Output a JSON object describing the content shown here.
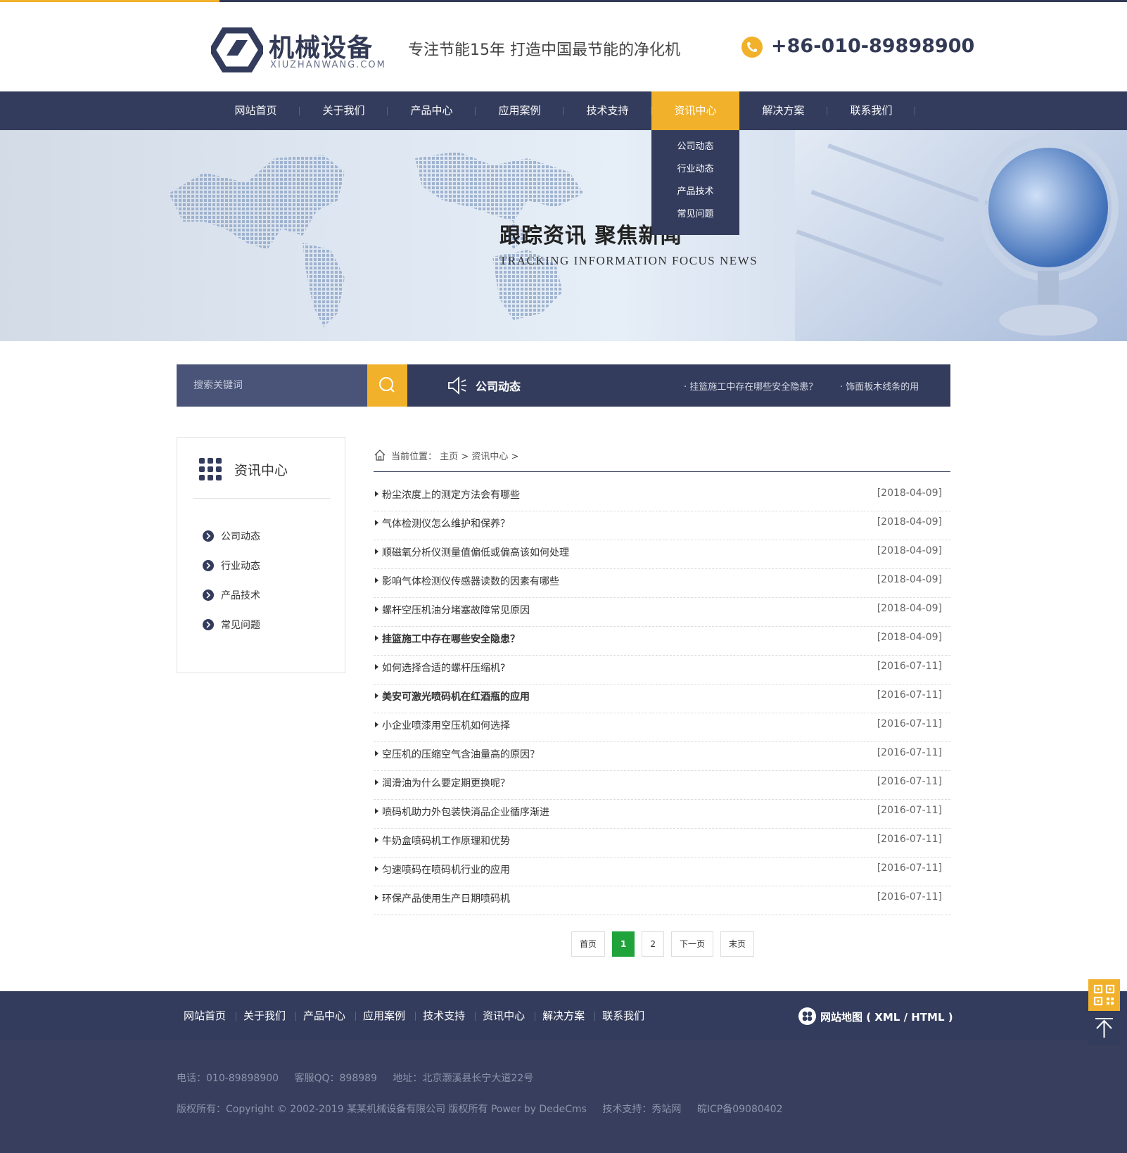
{
  "header": {
    "logo_title": "机械设备",
    "logo_sub": "XIUZHANWANG.COM",
    "slogan": "专注节能15年 打造中国最节能的净化机",
    "phone": "+86-010-89898900"
  },
  "nav": {
    "items": [
      "网站首页",
      "关于我们",
      "产品中心",
      "应用案例",
      "技术支持",
      "资讯中心",
      "解决方案",
      "联系我们"
    ],
    "active_index": 5,
    "dropdown": [
      "公司动态",
      "行业动态",
      "产品技术",
      "常见问题"
    ]
  },
  "banner": {
    "title": "跟踪资讯 聚焦新闻",
    "subtitle": "TRACKING INFORMATION FOCUS NEWS"
  },
  "search": {
    "placeholder": "搜索关键词",
    "ticker_label": "公司动态",
    "ticker_items": [
      "· 挂篮施工中存在哪些安全隐患？",
      "· 饰面板木线条的用"
    ]
  },
  "sidebar": {
    "title": "资讯中心",
    "items": [
      "公司动态",
      "行业动态",
      "产品技术",
      "常见问题"
    ]
  },
  "breadcrumb": {
    "prefix": "当前位置：",
    "home": "主页",
    "section": "资讯中心",
    "sep": ">"
  },
  "news": [
    {
      "title": "粉尘浓度上的测定方法会有哪些",
      "date": "[2018-04-09]",
      "bold": false
    },
    {
      "title": "气体检测仪怎么维护和保养？",
      "date": "[2018-04-09]",
      "bold": false
    },
    {
      "title": "顺磁氧分析仪测量值偏低或偏高该如何处理",
      "date": "[2018-04-09]",
      "bold": false
    },
    {
      "title": "影响气体检测仪传感器读数的因素有哪些",
      "date": "[2018-04-09]",
      "bold": false
    },
    {
      "title": "螺杆空压机油分堵塞故障常见原因",
      "date": "[2018-04-09]",
      "bold": false
    },
    {
      "title": "挂篮施工中存在哪些安全隐患？",
      "date": "[2018-04-09]",
      "bold": true
    },
    {
      "title": "如何选择合适的螺杆压缩机?",
      "date": "[2016-07-11]",
      "bold": false
    },
    {
      "title": "美安可激光喷码机在红酒瓶的应用",
      "date": "[2016-07-11]",
      "bold": true
    },
    {
      "title": "小企业喷漆用空压机如何选择",
      "date": "[2016-07-11]",
      "bold": false
    },
    {
      "title": "空压机的压缩空气含油量高的原因？",
      "date": "[2016-07-11]",
      "bold": false
    },
    {
      "title": "润滑油为什么要定期更换呢？",
      "date": "[2016-07-11]",
      "bold": false
    },
    {
      "title": "喷码机助力外包装快消品企业循序渐进",
      "date": "[2016-07-11]",
      "bold": false
    },
    {
      "title": "牛奶盒喷码机工作原理和优势",
      "date": "[2016-07-11]",
      "bold": false
    },
    {
      "title": "匀速喷码在喷码机行业的应用",
      "date": "[2016-07-11]",
      "bold": false
    },
    {
      "title": "环保产品使用生产日期喷码机",
      "date": "[2016-07-11]",
      "bold": false
    }
  ],
  "pager": {
    "first": "首页",
    "pages": [
      "1",
      "2"
    ],
    "current": "1",
    "next": "下一页",
    "last": "末页"
  },
  "footer_nav": {
    "items": [
      "网站首页",
      "关于我们",
      "产品中心",
      "应用案例",
      "技术支持",
      "资讯中心",
      "解决方案",
      "联系我们"
    ],
    "sitemap": "网站地图 ( XML / HTML )"
  },
  "footer": {
    "tel": "电话：010-89898900",
    "qq": "客服QQ：898989",
    "address": "地址：北京灏溪县长宁大道22号",
    "copyright": "版权所有：Copyright © 2002-2019 某某机械设备有限公司 版权所有 Power by DedeCms",
    "support": "技术支持：秀站网",
    "icp": "皖ICP备09080402"
  },
  "colors": {
    "brand_navy": "#333c5c",
    "accent_yellow": "#f2b12a",
    "pager_current": "#1fa33a"
  },
  "icons": {
    "logo": "hexagon-logo-icon",
    "phone": "phone-icon",
    "search": "search-icon",
    "ticker": "speaker-icon",
    "sidebar": "grid-icon",
    "breadcrumb": "home-icon",
    "sitemap": "sitemap-icon",
    "float_qr": "qr-code-icon",
    "float_top": "back-to-top-icon"
  }
}
